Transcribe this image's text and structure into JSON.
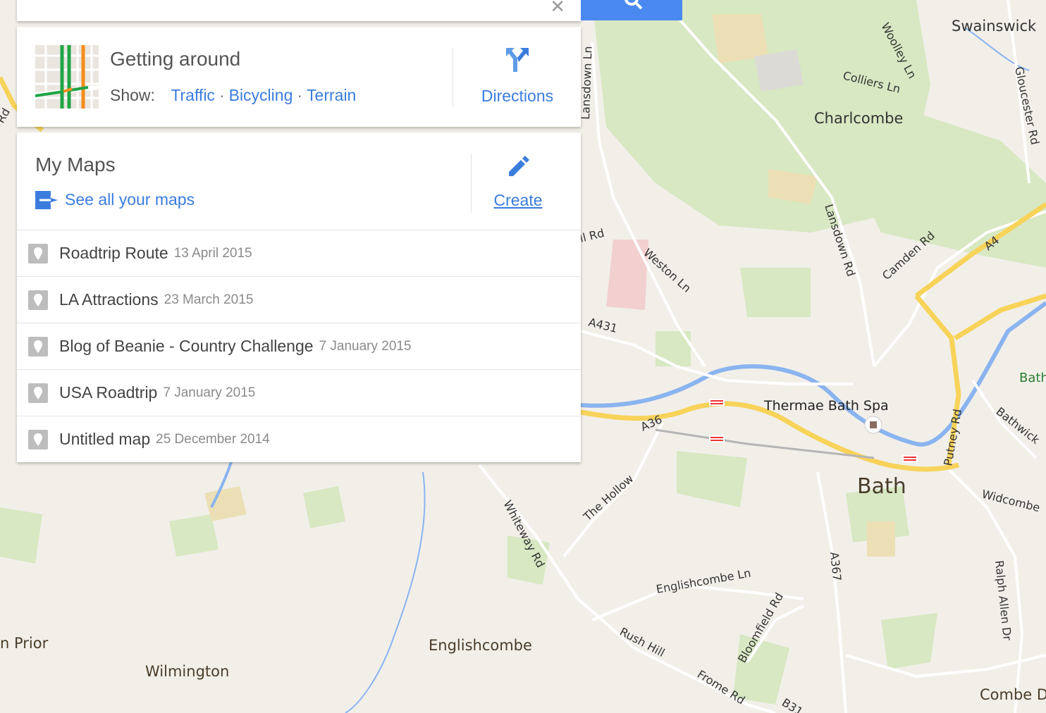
{
  "search": {
    "close_icon": "close-icon",
    "button_icon": "search-icon",
    "button_color": "#4a89f0"
  },
  "getting_around": {
    "title": "Getting around",
    "show_label": "Show:",
    "layers": [
      "Traffic",
      "Bicycling",
      "Terrain"
    ],
    "directions_label": "Directions",
    "directions_icon": "directions-fork-icon"
  },
  "my_maps": {
    "title": "My Maps",
    "see_all_label": "See all your maps",
    "see_all_icon": "open-maps-icon",
    "create_label": "Create",
    "create_icon": "pencil-icon",
    "items": [
      {
        "name": "Roadtrip Route",
        "date": "13 April 2015"
      },
      {
        "name": "LA Attractions",
        "date": "23 March 2015"
      },
      {
        "name": "Blog of Beanie - Country Challenge",
        "date": "7 January 2015"
      },
      {
        "name": "USA Roadtrip",
        "date": "7 January 2015"
      },
      {
        "name": "Untitled map",
        "date": "25 December 2014"
      }
    ],
    "item_icon": "map-pin-icon"
  },
  "map": {
    "places": {
      "swainswick": "Swainswick",
      "charlcombe": "Charlcombe",
      "thermae": "Thermae Bath Spa",
      "bath": "Bath",
      "englishcombe": "Englishcombe",
      "wilmington": "Wilmington",
      "prior": "n Prior",
      "combe": "Combe D",
      "bath_edge": "Bath"
    },
    "roads": {
      "woolley": "Woolley Ln",
      "colliers": "Colliers Ln",
      "gloucester": "Gloucester Rd",
      "lansdown_ln": "Lansdown Ln",
      "lansdown_rd": "Lansdown Rd",
      "camden": "Camden Rd",
      "a4": "A4",
      "weston": "Weston Ln",
      "ll_rd": "ll Rd",
      "a431": "A431",
      "a36": "A36",
      "bathwick": "Bathwick",
      "putney": "Putney Rd",
      "widcombe": "Widcombe",
      "the_hollow": "The Hollow",
      "whiteway": "Whiteway Rd",
      "a367": "A367",
      "englishcombe_ln": "Englishcombe Ln",
      "ralph_allen": "Ralph Allen Dr",
      "bloomfield": "Bloomfield Rd",
      "rush_hill": "Rush Hill",
      "frome": "Frome Rd",
      "b31": "B31",
      "rd_edge": "Rd"
    },
    "colors": {
      "land": "#f2efe9",
      "park": "#c6e2a8",
      "water": "#8ab4f0",
      "major_road": "#f8d35a",
      "minor_road": "#ffffff"
    }
  }
}
